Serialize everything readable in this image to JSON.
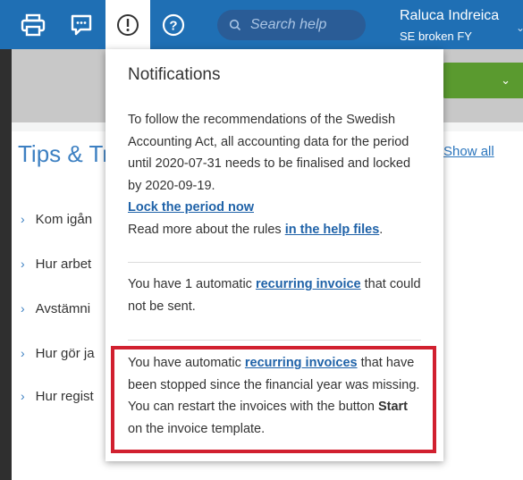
{
  "topbar": {
    "icons": [
      "printer-icon",
      "chat-icon",
      "notifications-icon",
      "help-icon"
    ],
    "search_placeholder": "Search help",
    "user_name": "Raluca Indreica",
    "company": "SE broken FY"
  },
  "page": {
    "tips_title": "Tips & Tr",
    "show_all": "Show all",
    "tips": [
      "Kom igån",
      "Hur arbet",
      "Avstämni",
      "Hur gör ja",
      "Hur regist"
    ]
  },
  "notifications": {
    "title": "Notifications",
    "msg1": {
      "text": "To follow the recommendations of the Swedish Accounting Act, all accounting data for the period until 2020-07-31 needs to be finalised and locked by 2020-09-19.",
      "lock_link": "Lock the period now",
      "read_more_prefix": "Read more about the rules ",
      "help_link": "in the help files",
      "read_more_suffix": "."
    },
    "msg2": {
      "prefix": "You have 1 automatic ",
      "link": "recurring invoice",
      "suffix": " that could not be sent."
    },
    "msg3": {
      "prefix": "You have automatic ",
      "link": "recurring invoices",
      "middle": " that have been stopped since the financial year was missing. You can restart the invoices with the button ",
      "bold": "Start",
      "suffix": " on the invoice template."
    }
  },
  "colors": {
    "topbar": "#1f6fb4",
    "link": "#1f62a8",
    "highlight_border": "#d1202f",
    "green_button": "#5a9a2f"
  }
}
